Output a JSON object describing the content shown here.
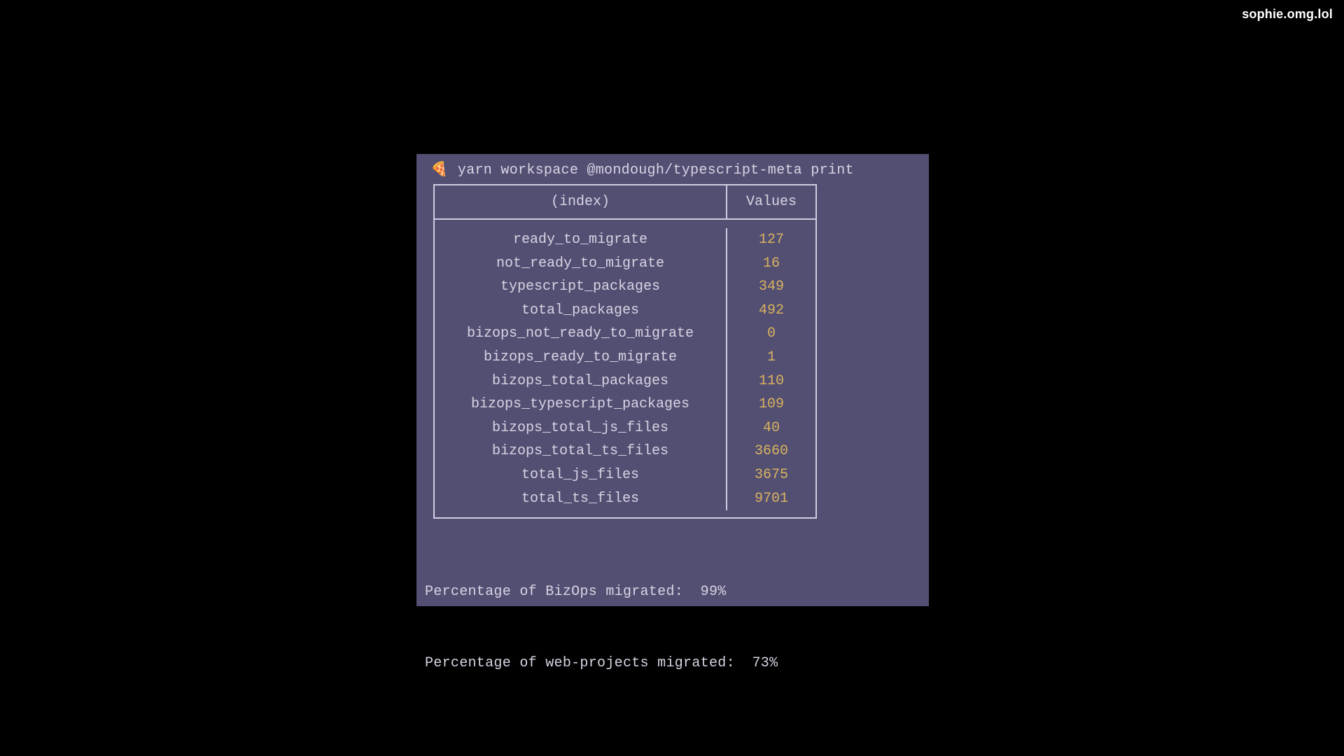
{
  "watermark": "sophie.omg.lol",
  "prompt": {
    "icon": "🍕",
    "command": "yarn workspace @mondough/typescript-meta print"
  },
  "table": {
    "headers": {
      "index": "(index)",
      "values": "Values"
    },
    "rows": [
      {
        "key": "ready_to_migrate",
        "value": "127"
      },
      {
        "key": "not_ready_to_migrate",
        "value": "16"
      },
      {
        "key": "typescript_packages",
        "value": "349"
      },
      {
        "key": "total_packages",
        "value": "492"
      },
      {
        "key": "bizops_not_ready_to_migrate",
        "value": "0"
      },
      {
        "key": "bizops_ready_to_migrate",
        "value": "1"
      },
      {
        "key": "bizops_total_packages",
        "value": "110"
      },
      {
        "key": "bizops_typescript_packages",
        "value": "109"
      },
      {
        "key": "bizops_total_js_files",
        "value": "40"
      },
      {
        "key": "bizops_total_ts_files",
        "value": "3660"
      },
      {
        "key": "total_js_files",
        "value": "3675"
      },
      {
        "key": "total_ts_files",
        "value": "9701"
      }
    ]
  },
  "summary": {
    "line1": "Percentage of BizOps migrated:  99%",
    "line2": "Percentage of web-projects migrated:  73%"
  }
}
